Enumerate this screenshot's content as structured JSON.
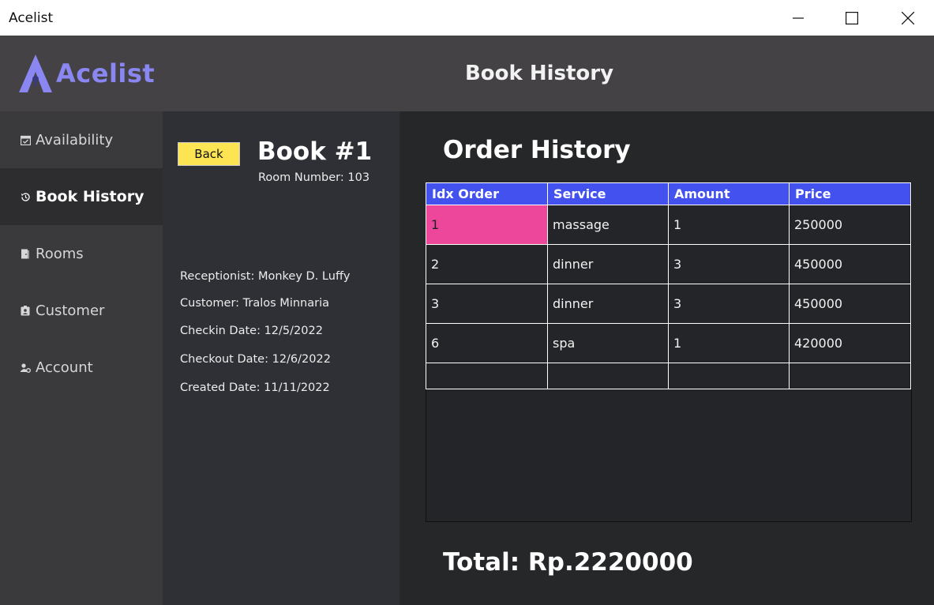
{
  "window": {
    "title": "Acelist"
  },
  "brand": {
    "name": "Acelist",
    "color": "#8a87f2"
  },
  "header": {
    "title": "Book History"
  },
  "sidebar": {
    "items": [
      {
        "label": "Availability",
        "icon": "calendar-check-icon"
      },
      {
        "label": "Book History",
        "icon": "history-icon",
        "active": true
      },
      {
        "label": "Rooms",
        "icon": "door-icon"
      },
      {
        "label": "Customer",
        "icon": "id-badge-icon"
      },
      {
        "label": "Account",
        "icon": "user-gear-icon"
      }
    ]
  },
  "booking": {
    "back_label": "Back",
    "title": "Book #1",
    "room_number": "Room Number: 103",
    "receptionist": "Receptionist: Monkey D. Luffy",
    "customer": "Customer: Tralos Minnaria",
    "checkin": "Checkin Date: 12/5/2022",
    "checkout": "Checkout Date: 12/6/2022",
    "created": "Created Date: 11/11/2022"
  },
  "orders": {
    "title": "Order History",
    "columns": [
      "Idx Order",
      "Service",
      "Amount",
      "Price"
    ],
    "rows": [
      [
        "1",
        "massage",
        "1",
        "250000"
      ],
      [
        "2",
        "dinner",
        "3",
        "450000"
      ],
      [
        "3",
        "dinner",
        "3",
        "450000"
      ],
      [
        "6",
        "spa",
        "1",
        "420000"
      ]
    ],
    "header_color": "#4352ee",
    "selected_color": "#ec479a"
  },
  "total": "Total: Rp.2220000"
}
